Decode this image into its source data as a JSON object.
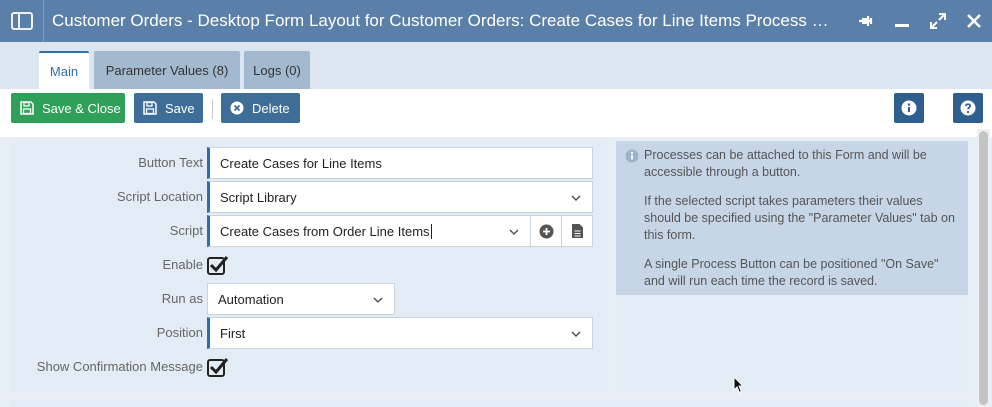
{
  "window": {
    "title": "Customer Orders - Desktop Form Layout for Customer Orders: Create Cases for Line Items Process But...",
    "panel_icon": "panel-layout-icon",
    "controls": [
      "pin-icon",
      "minimize-icon",
      "maximize-icon",
      "close-icon"
    ]
  },
  "tabs": [
    {
      "label": "Main",
      "active": true
    },
    {
      "label": "Parameter Values (8)",
      "active": false
    },
    {
      "label": "Logs (0)",
      "active": false
    }
  ],
  "toolbar": {
    "save_close_label": "Save & Close",
    "save_label": "Save",
    "delete_label": "Delete"
  },
  "form": {
    "button_text": {
      "label": "Button Text",
      "value": "Create Cases for Line Items"
    },
    "script_location": {
      "label": "Script Location",
      "value": "Script Library"
    },
    "script": {
      "label": "Script",
      "value": "Create Cases from Order Line Items"
    },
    "enable": {
      "label": "Enable",
      "checked": true
    },
    "run_as": {
      "label": "Run as",
      "value": "Automation"
    },
    "position": {
      "label": "Position",
      "value": "First"
    },
    "show_confirmation": {
      "label": "Show Confirmation Message",
      "checked": true
    }
  },
  "info": {
    "p1": "Processes can be attached to this Form and will be accessible through a button.",
    "p2": "If the selected script takes parameters their values should be specified using the \"Parameter Values\" tab on this form.",
    "p3": "A single Process Button can be positioned \"On Save\" and will run each time the record is saved."
  },
  "colors": {
    "titlebar": "#5a7fa8",
    "save_green": "#2ea05a",
    "primary_blue": "#3e6d98",
    "accent": "#2f6fa8"
  }
}
